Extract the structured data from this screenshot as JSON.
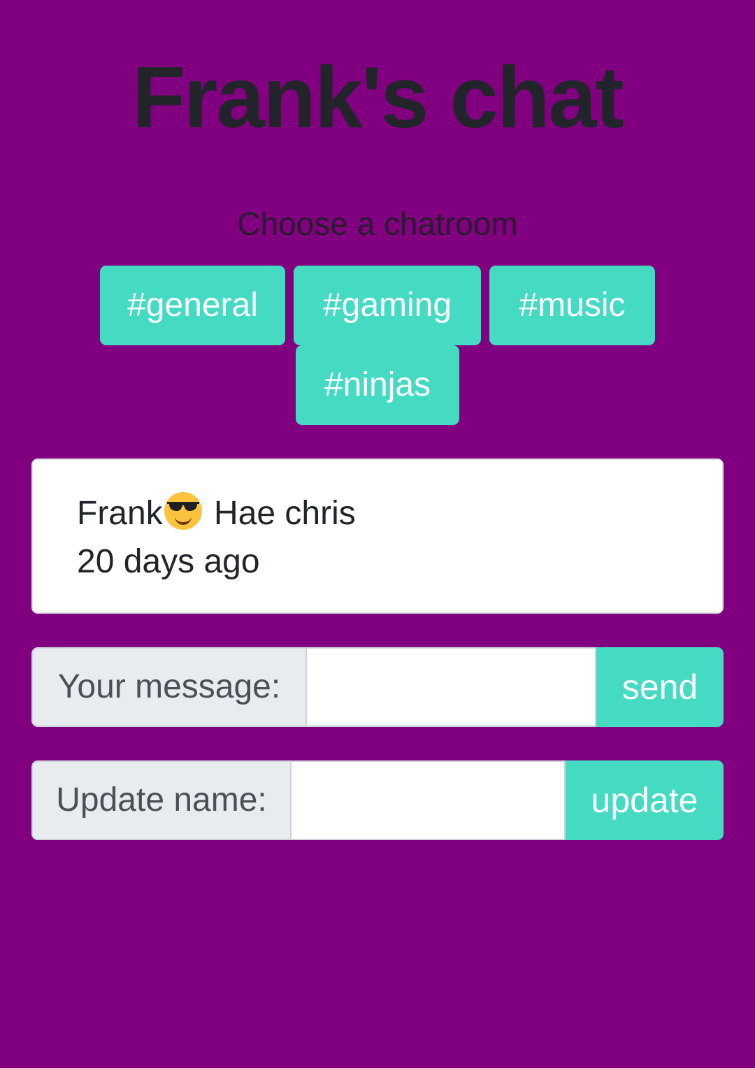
{
  "header": {
    "title": "Frank's chat",
    "subtitle": "Choose a chatroom"
  },
  "rooms": [
    {
      "label": "#general"
    },
    {
      "label": "#gaming"
    },
    {
      "label": "#music"
    },
    {
      "label": "#ninjas"
    }
  ],
  "messages": [
    {
      "author": "Frank",
      "emoji": "sunglasses-smiley",
      "text": "Hae chris",
      "time": "20 days ago"
    }
  ],
  "message_form": {
    "label": "Your message:",
    "value": "",
    "button": "send"
  },
  "name_form": {
    "label": "Update name:",
    "value": "",
    "button": "update"
  },
  "colors": {
    "background": "#800080",
    "accent": "#45dac2",
    "text": "#212529"
  }
}
